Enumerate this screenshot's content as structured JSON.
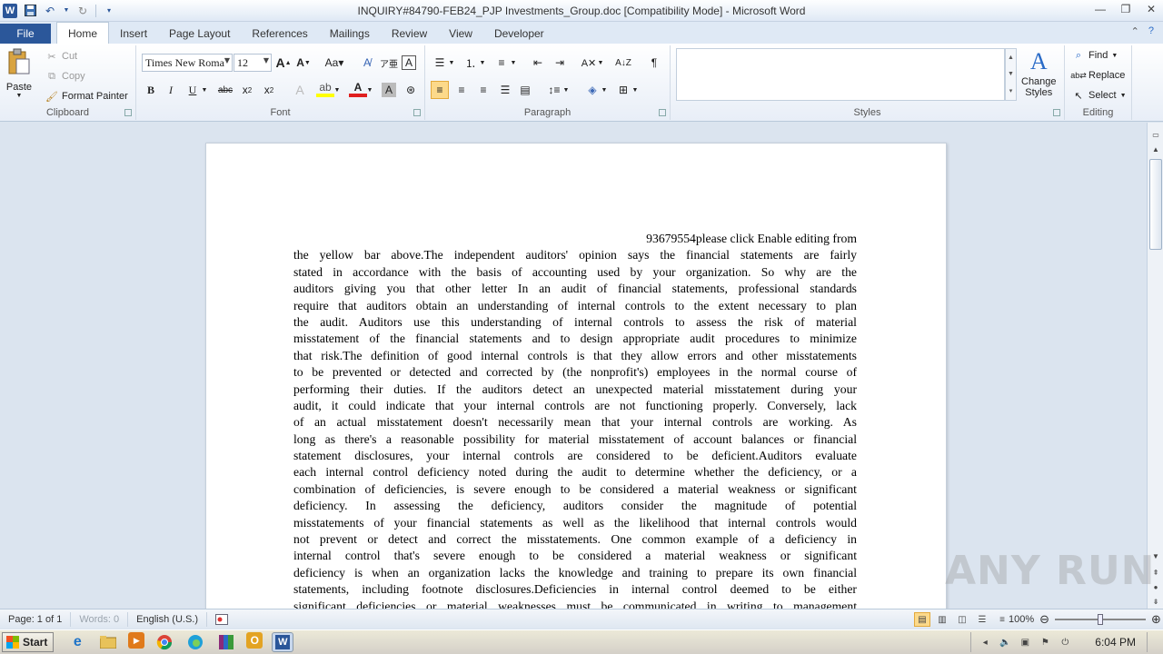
{
  "titlebar": {
    "title": "INQUIRY#84790-FEB24_PJP Investments_Group.doc [Compatibility Mode] - Microsoft Word",
    "app_icon_letter": "W"
  },
  "tabs": {
    "file": "File",
    "items": [
      "Home",
      "Insert",
      "Page Layout",
      "References",
      "Mailings",
      "Review",
      "View",
      "Developer"
    ],
    "active": "Home"
  },
  "ribbon": {
    "clipboard": {
      "label": "Clipboard",
      "paste": "Paste",
      "cut": "Cut",
      "copy": "Copy",
      "format_painter": "Format Painter"
    },
    "font": {
      "label": "Font",
      "font_name": "Times New Roma",
      "font_size": "12"
    },
    "paragraph": {
      "label": "Paragraph"
    },
    "styles": {
      "label": "Styles",
      "change_styles": "Change",
      "change_styles_2": "Styles"
    },
    "editing": {
      "label": "Editing",
      "find": "Find",
      "replace": "Replace",
      "select": "Select"
    }
  },
  "document": {
    "lines": [
      "93679554please click Enable editing from",
      "the yellow bar above.The independent auditors' opinion says the financial statements are fairly",
      "stated in accordance with the basis of accounting used by your organization. So why are the",
      "auditors giving you that other letter In an audit of financial statements, professional standards",
      "require that auditors obtain an understanding of internal controls to the extent necessary to plan",
      "the audit. Auditors use this understanding of internal controls to assess the risk of material",
      "misstatement of the financial statements and to design appropriate audit procedures to minimize",
      "that risk.The definition of good internal controls is that they allow errors and other misstatements",
      "to be prevented or detected and corrected by (the nonprofit's) employees in the normal course of",
      "performing their duties. If the auditors detect an unexpected material misstatement during your",
      "audit, it could indicate that your internal controls are not functioning properly. Conversely, lack",
      "of an actual misstatement doesn't necessarily mean that your internal controls are working. As",
      "long as there's a reasonable possibility for material misstatement of account balances or financial",
      "statement disclosures, your internal controls are considered to be deficient.Auditors evaluate",
      "each internal control deficiency noted during the audit to determine whether the deficiency, or a",
      "combination of deficiencies, is severe enough to be considered a material weakness or significant",
      "deficiency. In assessing the deficiency, auditors consider the magnitude of potential",
      "misstatements of your financial statements as well as the likelihood that internal controls would",
      "not prevent or detect and correct the misstatements. One common example of a deficiency in",
      "internal control that's severe enough to be considered a material weakness or significant",
      "deficiency is when an organization lacks the knowledge and training to prepare its own financial",
      "statements, including footnote disclosures.Deficiencies in internal control deemed to be either",
      "significant deficiencies or material weaknesses must be communicated in writing to management"
    ]
  },
  "watermark": "ANY RUN",
  "statusbar": {
    "page": "Page: 1 of 1",
    "words": "Words: 0",
    "language": "English (U.S.)",
    "zoom": "100%",
    "zoom_fraction": 0.5
  },
  "taskbar": {
    "start": "Start",
    "clock": "6:04 PM",
    "apps": [
      "ie-icon",
      "explorer-icon",
      "media-player-icon",
      "chrome-icon",
      "edge-icon",
      "winrar-icon",
      "outlook-icon",
      "word-icon"
    ]
  }
}
